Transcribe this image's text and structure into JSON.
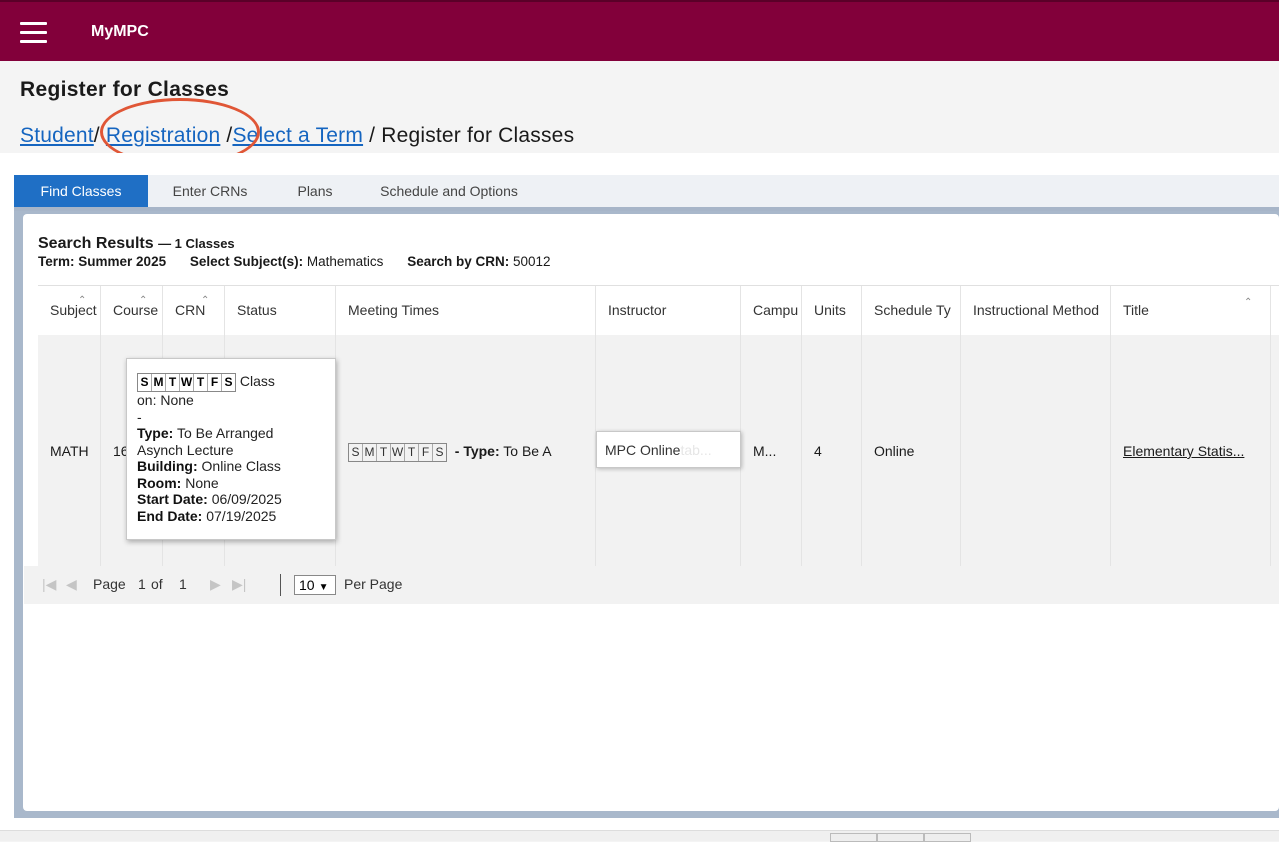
{
  "header": {
    "brand": "MyMPC"
  },
  "page": {
    "title": "Register for Classes",
    "breadcrumb": {
      "student": "Student",
      "registration": "Registration",
      "select_term": "Select a Term",
      "current": "Register for Classes",
      "separator": "/"
    }
  },
  "tabs": [
    {
      "label": "Find Classes",
      "active": true
    },
    {
      "label": "Enter CRNs"
    },
    {
      "label": "Plans"
    },
    {
      "label": "Schedule and Options"
    }
  ],
  "search": {
    "title": "Search Results",
    "count": "— 1 Classes",
    "term_label": "Term:",
    "term_value": "Summer 2025",
    "subject_label": "Select Subject(s):",
    "subject_value": "Mathematics",
    "crn_label": "Search by CRN:",
    "crn_value": "50012"
  },
  "table": {
    "headers": [
      "Subject",
      "Course",
      "CRN",
      "Status",
      "Meeting Times",
      "Instructor",
      "Campu",
      "Units",
      "Schedule Ty",
      "Instructional Method",
      "Title"
    ],
    "row": {
      "subject": "MATH",
      "course": "16",
      "crn": "",
      "status": "",
      "meeting_type_label": "- Type:",
      "meeting_type_value": "To Be A",
      "instructor": "",
      "campus": "M...",
      "units": "4",
      "schedule_type": "Online",
      "instructional_method": "",
      "title": "Elementary Statis..."
    },
    "days": [
      "S",
      "M",
      "T",
      "W",
      "T",
      "F",
      "S"
    ]
  },
  "tooltip": {
    "class_on": "Class",
    "on_none": "on: None",
    "dash": "-",
    "type_label": "Type:",
    "type_value": "To Be Arranged",
    "type_value2": "Asynch Lecture",
    "building_label": "Building:",
    "building_value": "Online Class",
    "room_label": "Room:",
    "room_value": "None",
    "start_label": "Start Date:",
    "start_value": "06/09/2025",
    "end_label": "End Date:",
    "end_value": "07/19/2025"
  },
  "instructor_popup": {
    "text": "MPC Online",
    "faded": "tab..."
  },
  "pager": {
    "page_label": "Page",
    "current": "1",
    "of_label": "of",
    "total": "1",
    "per_page_value": "10",
    "per_page_label": "Per Page"
  },
  "icons": {
    "menu": "hamburger-icon",
    "sort": "sort-arrows-icon",
    "first": "first-page-icon",
    "prev": "prev-page-icon",
    "next": "next-page-icon",
    "last": "last-page-icon",
    "dropdown": "chevron-down-icon"
  },
  "colors": {
    "brand": "#82003a",
    "tab_active": "#1f6fc5",
    "link": "#1565c0",
    "annotation": "#e05636"
  }
}
